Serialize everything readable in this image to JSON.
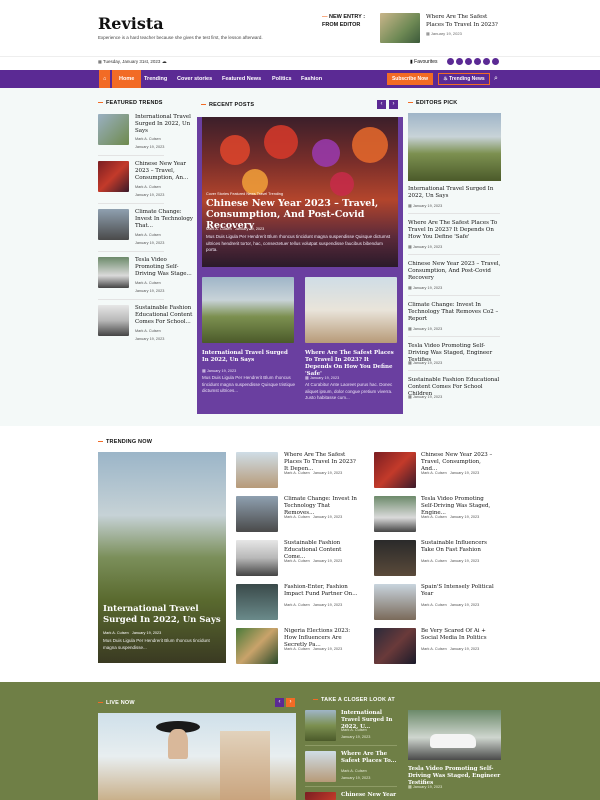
{
  "brand": {
    "logo": "Revista",
    "tagline": "Experience is a hard teacher because she gives the test first, the lesson afterward."
  },
  "new_entry": {
    "label_line1": "NEW ENTRY :",
    "label_line2": "FROM EDITOR",
    "title": "Where Are The Safest Places To Travel In 2023?",
    "date": "January 19, 2023"
  },
  "topbar": {
    "date": "Tuesday, January 31st, 2023",
    "favourites": "Favourites"
  },
  "nav": {
    "items": [
      "Home",
      "Trending",
      "Cover stories",
      "Featured News",
      "Politics",
      "Fashion"
    ],
    "subscribe": "Subscribe Now",
    "trending_news": "Trending News"
  },
  "featured_trends": {
    "heading": "FEATURED TRENDS",
    "items": [
      {
        "title": "International Travel Surged In 2022, Un Says",
        "author": "Mark A. Culsen",
        "date": "January 19, 2023"
      },
      {
        "title": "Chinese New Year 2023 – Travel, Consumption, An...",
        "author": "Mark A. Culsen",
        "date": "January 19, 2023"
      },
      {
        "title": "Climate Change: Invest In Technology That...",
        "author": "Mark A. Culsen",
        "date": "January 19, 2023"
      },
      {
        "title": "Tesla Video Promoting Self-Driving Was Stage...",
        "author": "Mark A. Culsen",
        "date": "January 19, 2023"
      },
      {
        "title": "Sustainable Fashion Educational Content Comes For School...",
        "author": "Mark A. Culsen",
        "date": "January 19, 2023"
      }
    ]
  },
  "recent_posts": {
    "heading": "RECENT POSTS",
    "hero": {
      "tag": "Cover Stories  Featured News  Travel  Trending",
      "title": "Chinese New Year 2023 – Travel, Consumption, And Post-Covid Recovery",
      "author": "Mark A. Culsen",
      "date": "January 19, 2023",
      "excerpt": "Mus Duis Ligula Per Hendrerit Blum rhoncus tincidunt magna suspendisse Quisque dictumst ultrices hendrerit tortor, hac, consectetuer tellus volutpat suspendisse faucibus bibendum porta."
    },
    "sub": [
      {
        "title": "International Travel Surged In 2022, Un Says",
        "date": "January 19, 2023",
        "excerpt": "Mus Duis Ligula Per Hendrerit Blum rhoncus tincidunt magna suspendisse Quisque tristique dictumst ultrices..."
      },
      {
        "title": "Where Are The Safest Places To Travel In 2023? It Depends On How You Define 'Safe'",
        "date": "January 19, 2023",
        "excerpt": "At Curabitur Ante Laoreet purus hac. Donec aliquet ipsum, dolor congue pretium viverra. Justo habitasse cum..."
      }
    ]
  },
  "editors_pick": {
    "heading": "EDITORS PICK",
    "items": [
      {
        "title": "International Travel Surged In 2022, Un Says",
        "date": "January 19, 2023"
      },
      {
        "title": "Where Are The Safest Places To Travel In 2023? It Depends On How You Define 'Safe'",
        "date": "January 19, 2023"
      },
      {
        "title": "Chinese New Year 2023 – Travel, Consumption, And Post-Covid Recovery",
        "date": "January 19, 2023"
      },
      {
        "title": "Climate Change: Invest In Technology That Removes Co2 – Report",
        "date": "January 19, 2023"
      },
      {
        "title": "Tesla Video Promoting Self-Driving Was Staged, Engineer Testifies",
        "date": "January 19, 2023"
      },
      {
        "title": "Sustainable Fashion Educational Content Comes For School Children",
        "date": "January 19, 2023"
      }
    ]
  },
  "trending_now": {
    "heading": "TRENDING NOW",
    "big": {
      "title": "International Travel Surged In 2022, Un Says",
      "author": "Mark A. Culsen",
      "date": "January 19, 2023",
      "excerpt": "Mus Duis Ligula Per Hendrerit Blum rhoncus tincidunt magna suspendisse..."
    },
    "col1": [
      {
        "title": "Where Are The Safest Places To Travel In 2023? It Depen...",
        "author": "Mark A. Culsen",
        "date": "January 19, 2023"
      },
      {
        "title": "Climate Change: Invest In Technology That Removes...",
        "author": "Mark A. Culsen",
        "date": "January 19, 2023"
      },
      {
        "title": "Sustainable Fashion Educational Content Come...",
        "author": "Mark A. Culsen",
        "date": "January 19, 2023"
      },
      {
        "title": "Fashion-Enter, Fashion Impact Fund Partner On...",
        "author": "Mark A. Culsen",
        "date": "January 19, 2023"
      },
      {
        "title": "Nigeria Elections 2023: How Influencers Are Secretly Pa...",
        "author": "Mark A. Culsen",
        "date": "January 19, 2023"
      }
    ],
    "col2": [
      {
        "title": "Chinese New Year 2023 – Travel, Consumption, And...",
        "author": "Mark A. Culsen",
        "date": "January 19, 2023"
      },
      {
        "title": "Tesla Video Promoting Self-Driving Was Staged, Engine...",
        "author": "Mark A. Culsen",
        "date": "January 19, 2023"
      },
      {
        "title": "Sustainable Influencers Take On Fast Fashion",
        "author": "Mark A. Culsen",
        "date": "January 19, 2023"
      },
      {
        "title": "Spain'S Intensely Political Year",
        "author": "Mark A. Culsen",
        "date": "January 19, 2023"
      },
      {
        "title": "Be Very Scared Of Ai + Social Media In Politics",
        "author": "Mark A. Culsen",
        "date": "January 19, 2023"
      }
    ]
  },
  "live_now": {
    "heading": "LIVE NOW"
  },
  "closer_look": {
    "heading": "TAKE A CLOSER LOOK AT",
    "items": [
      {
        "title": "International Travel Surged In 2022, U...",
        "author": "Mark A. Culsen",
        "date": "January 19, 2023"
      },
      {
        "title": "Where Are The Safest Places To...",
        "author": "Mark A. Culsen",
        "date": "January 19, 2023"
      },
      {
        "title": "Chinese New Year",
        "author": "",
        "date": ""
      }
    ],
    "feature": {
      "title": "Tesla Video Promoting Self-Driving Was Staged, Engineer Testifies",
      "date": "January 19, 2023"
    }
  },
  "colors": {
    "brand_purple": "#5b2a94",
    "accent_orange": "#f26b25",
    "olive": "#6f7f46"
  }
}
